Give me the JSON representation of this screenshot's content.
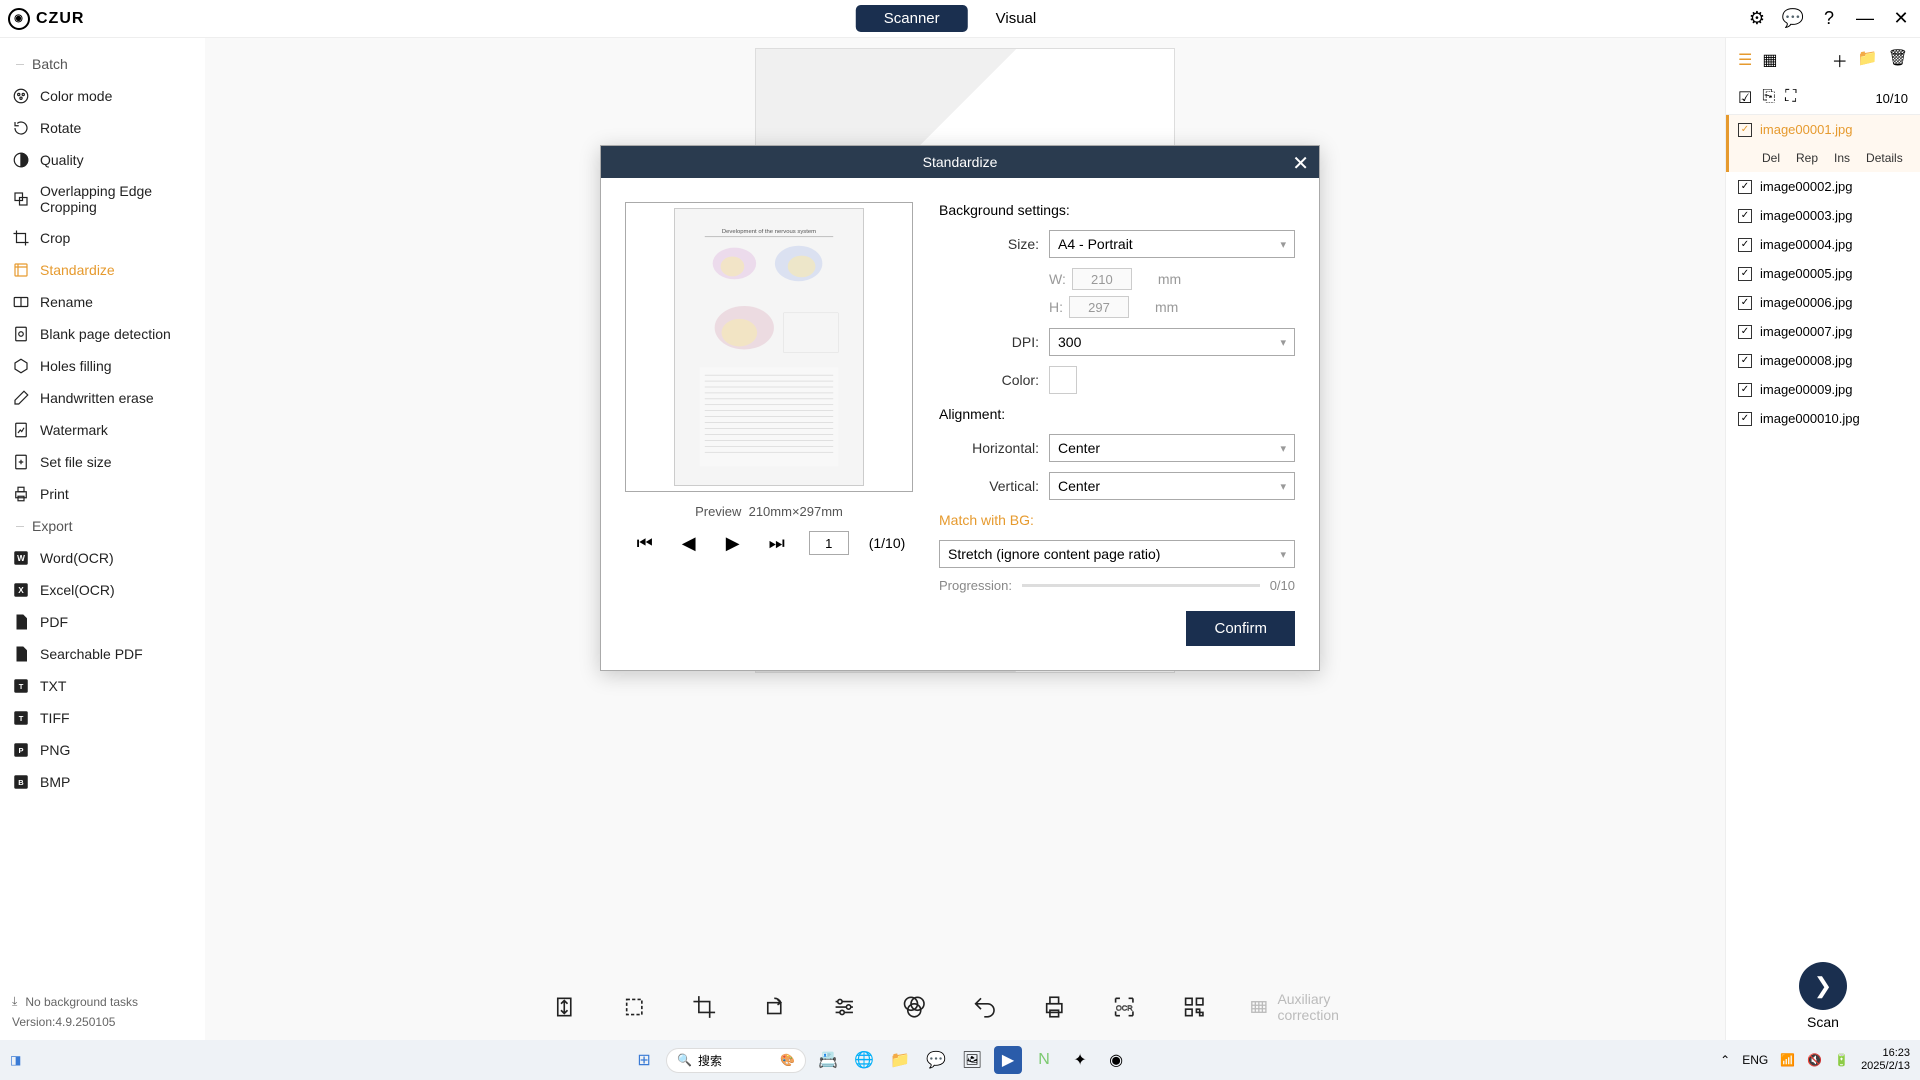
{
  "app": {
    "name": "CZUR"
  },
  "tabs": {
    "scanner": "Scanner",
    "visual": "Visual"
  },
  "sidebar": {
    "batch_header": "Batch",
    "items": [
      {
        "label": "Color mode"
      },
      {
        "label": "Rotate"
      },
      {
        "label": "Quality"
      },
      {
        "label": "Overlapping Edge Cropping"
      },
      {
        "label": "Crop"
      },
      {
        "label": "Standardize",
        "active": true
      },
      {
        "label": "Rename"
      },
      {
        "label": "Blank page detection"
      },
      {
        "label": "Holes filling"
      },
      {
        "label": "Handwritten erase"
      },
      {
        "label": "Watermark"
      },
      {
        "label": "Set file size"
      },
      {
        "label": "Print"
      }
    ],
    "export_header": "Export",
    "exports": [
      {
        "label": "Word(OCR)"
      },
      {
        "label": "Excel(OCR)"
      },
      {
        "label": "PDF"
      },
      {
        "label": "Searchable PDF"
      },
      {
        "label": "TXT"
      },
      {
        "label": "TIFF"
      },
      {
        "label": "PNG"
      },
      {
        "label": "BMP"
      }
    ],
    "footer_tasks": "No background tasks",
    "version": "Version:4.9.250105"
  },
  "toolbar": {
    "aux": "Auxiliary correction"
  },
  "rightpanel": {
    "counter": "10/10",
    "files": [
      "image00001.jpg",
      "image00002.jpg",
      "image00003.jpg",
      "image00004.jpg",
      "image00005.jpg",
      "image00006.jpg",
      "image00007.jpg",
      "image00008.jpg",
      "image00009.jpg",
      "image000010.jpg"
    ],
    "actions": {
      "del": "Del",
      "rep": "Rep",
      "ins": "Ins",
      "details": "Details"
    },
    "scan": "Scan"
  },
  "modal": {
    "title": "Standardize",
    "preview_caption_prefix": "Preview",
    "preview_dims": "210mm×297mm",
    "page_current": "1",
    "page_total": "(1/10)",
    "bg_title": "Background settings:",
    "size_label": "Size:",
    "size_value": "A4 - Portrait",
    "w_label": "W:",
    "w_value": "210",
    "h_label": "H:",
    "h_value": "297",
    "unit": "mm",
    "dpi_label": "DPI:",
    "dpi_value": "300",
    "color_label": "Color:",
    "align_title": "Alignment:",
    "horiz_label": "Horizontal:",
    "horiz_value": "Center",
    "vert_label": "Vertical:",
    "vert_value": "Center",
    "match_title": "Match with BG:",
    "match_value": "Stretch (ignore content page ratio)",
    "progress_label": "Progression:",
    "progress_value": "0/10",
    "confirm": "Confirm"
  },
  "taskbar": {
    "search": "搜索",
    "lang": "ENG",
    "time": "16:23",
    "date": "2025/2/13"
  }
}
